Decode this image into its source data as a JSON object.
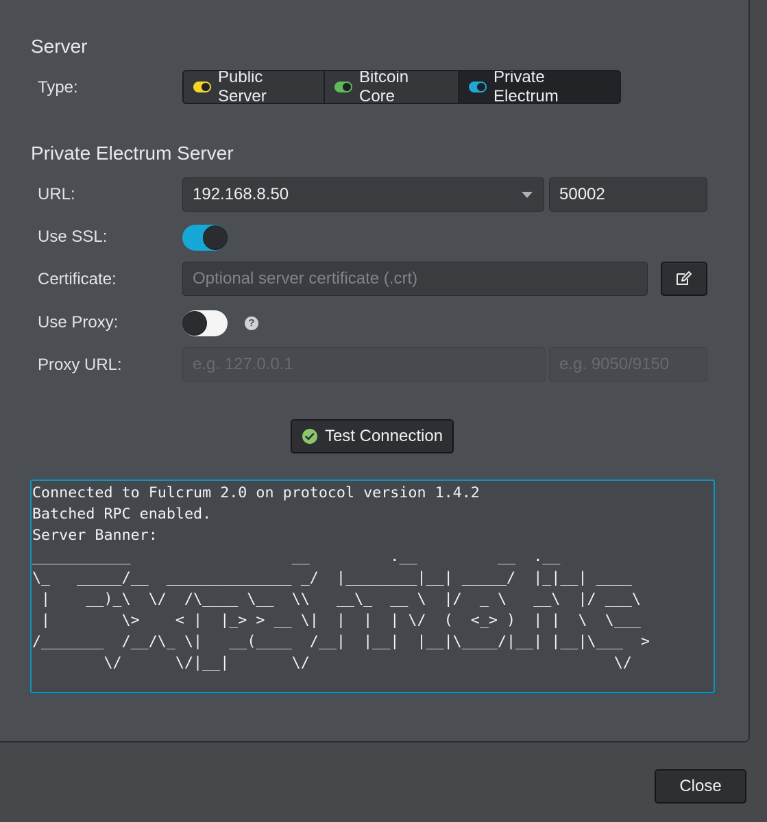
{
  "server": {
    "section_title": "Server",
    "type_label": "Type:",
    "types": [
      {
        "label": "Public Server",
        "color": "#f2d42a",
        "selected": false
      },
      {
        "label": "Bitcoin Core",
        "color": "#5fba5a",
        "selected": false
      },
      {
        "label": "Private Electrum",
        "color": "#1fa8d6",
        "selected": true
      }
    ]
  },
  "private_server": {
    "section_title": "Private Electrum Server",
    "url_label": "URL:",
    "url_value": "192.168.8.50",
    "port_value": "50002",
    "ssl_label": "Use SSL:",
    "ssl_on": true,
    "certificate_label": "Certificate:",
    "certificate_placeholder": "Optional server certificate (.crt)",
    "edit_icon": "edit-icon",
    "proxy_label": "Use Proxy:",
    "proxy_on": false,
    "proxy_help": "?",
    "proxy_url_label": "Proxy URL:",
    "proxy_url_placeholder": "e.g. 127.0.0.1",
    "proxy_port_placeholder": "e.g. 9050/9150"
  },
  "test_button": {
    "label": "Test Connection",
    "icon": "check-circle-icon",
    "icon_color": "#8cc66a"
  },
  "console": {
    "lines": [
      "Connected to Fulcrum 2.0 on protocol version 1.4.2",
      "Batched RPC enabled.",
      "Server Banner:",
      "___________                  __         .__         __  .__",
      "\\_   _____/__  ______________ _/  |________|__| _____/  |_|__| ____",
      " |    __)_\\  \\/  /\\____ \\__  \\\\   __\\_  __ \\  |/  _ \\   __\\  |/ ___\\",
      " |        \\>    < |  |_> > __ \\|  |  |  | \\/  (  <_> )  | |  \\  \\___",
      "/_______  /__/\\_ \\|   __(____  /__|  |__|  |__|\\____/|__| |__|\\___  >",
      "        \\/      \\/|__|       \\/                                  \\/"
    ]
  },
  "footer": {
    "close_label": "Close"
  }
}
